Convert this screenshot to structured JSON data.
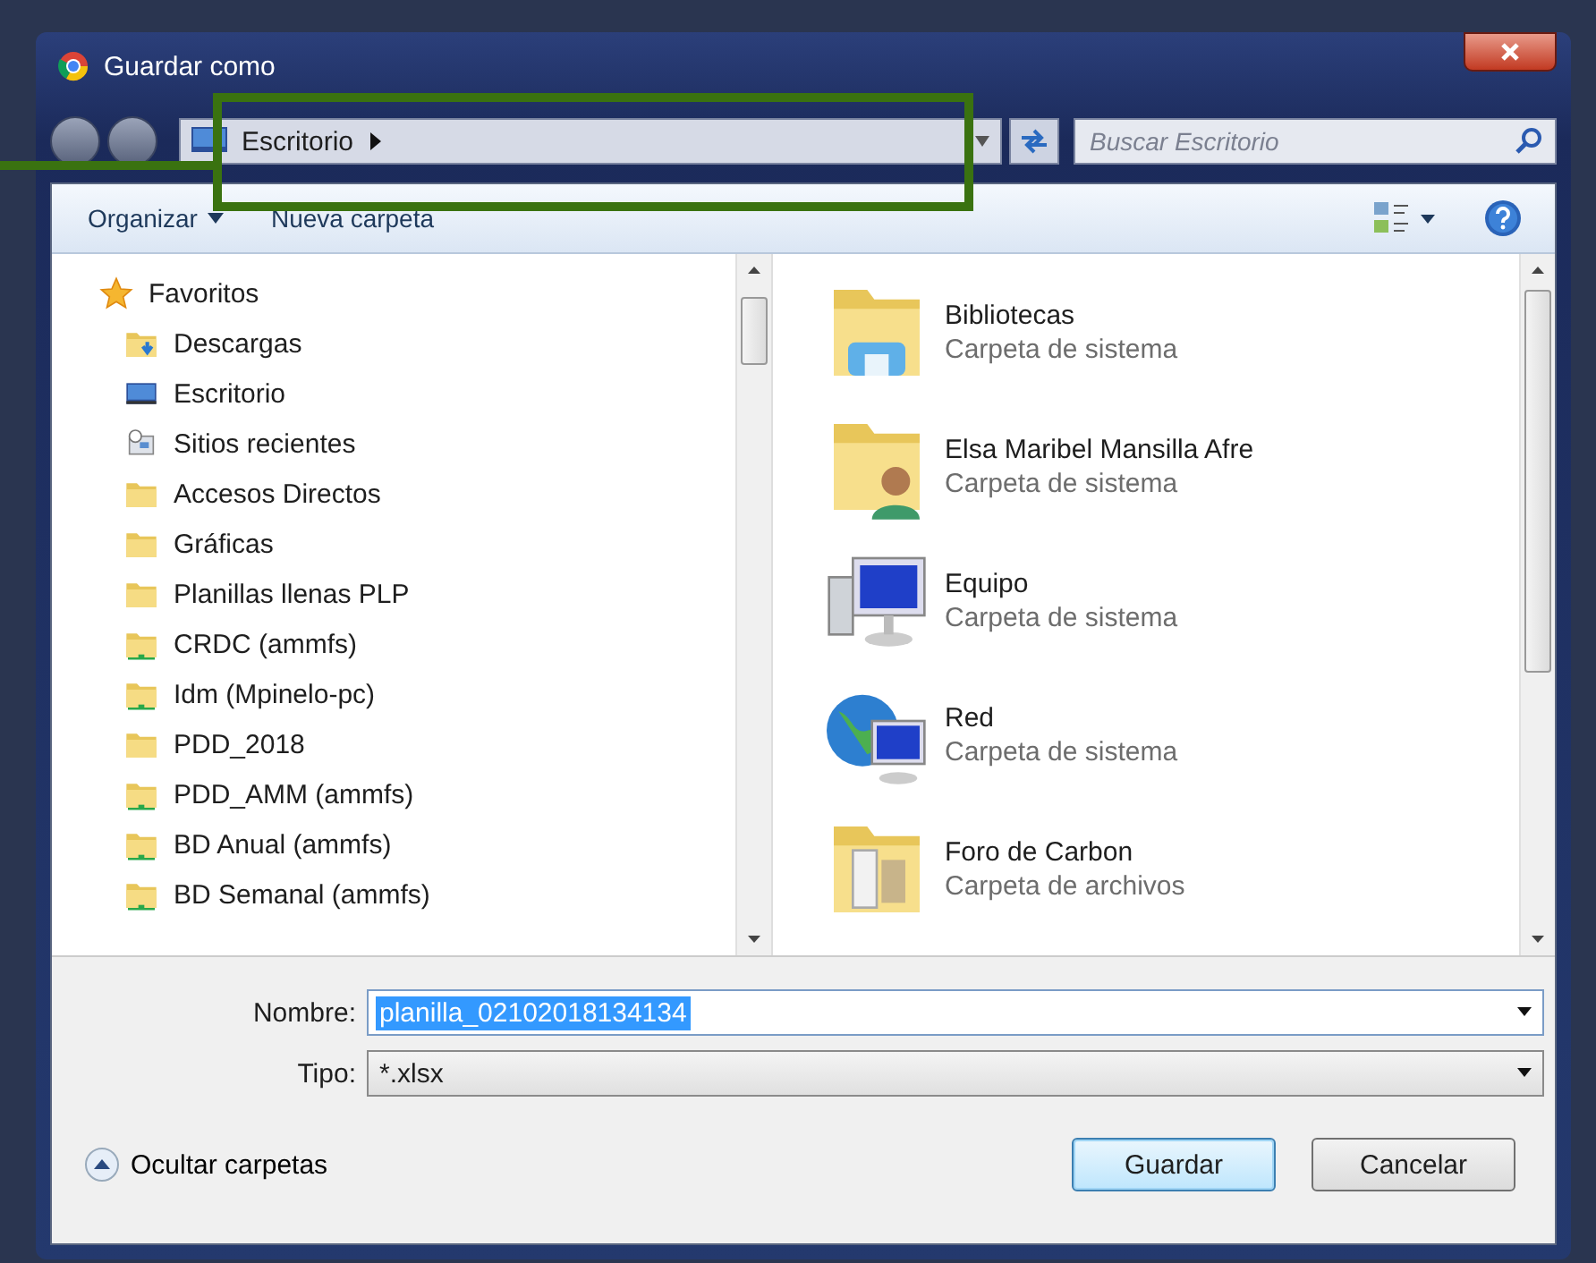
{
  "window": {
    "title": "Guardar como"
  },
  "address": {
    "path": "Escritorio"
  },
  "search": {
    "placeholder": "Buscar Escritorio"
  },
  "toolbar": {
    "items": [
      "Organizar",
      "Nueva carpeta"
    ]
  },
  "sidebar": {
    "items": [
      {
        "label": "Favoritos",
        "kind": "star",
        "children": [
          {
            "label": "Descargas",
            "kind": "downloads"
          },
          {
            "label": "Escritorio",
            "kind": "desktop"
          },
          {
            "label": "Sitios recientes",
            "kind": "recent"
          },
          {
            "label": "Accesos Directos",
            "kind": "folder"
          },
          {
            "label": "Gráficas",
            "kind": "folder"
          },
          {
            "label": "Planillas llenas PLP",
            "kind": "folder"
          },
          {
            "label": "CRDC (ammfs)",
            "kind": "network"
          },
          {
            "label": "Idm (Mpinelo-pc)",
            "kind": "network"
          },
          {
            "label": "PDD_2018",
            "kind": "folder"
          },
          {
            "label": "PDD_AMM (ammfs)",
            "kind": "network"
          },
          {
            "label": "BD Anual (ammfs)",
            "kind": "network"
          },
          {
            "label": "BD Semanal (ammfs)",
            "kind": "network"
          }
        ]
      }
    ]
  },
  "files": [
    {
      "name": "Bibliotecas",
      "type": "Carpeta de sistema",
      "kind": "libraries"
    },
    {
      "name": "Elsa Maribel Mansilla Afre",
      "type": "Carpeta de sistema",
      "kind": "user"
    },
    {
      "name": "Equipo",
      "type": "Carpeta de sistema",
      "kind": "computer"
    },
    {
      "name": "Red",
      "type": "Carpeta de sistema",
      "kind": "network"
    },
    {
      "name": "Foro de Carbon",
      "type": "Carpeta de archivos",
      "kind": "folder"
    }
  ],
  "form": [
    {
      "label": "Nombre:",
      "value": "planilla_02102018134134",
      "selected": true
    },
    {
      "label": "Tipo:",
      "value": "*.xlsx",
      "selected": false
    }
  ],
  "hide_folders": "Ocultar carpetas",
  "buttons": [
    {
      "label": "Guardar",
      "default": true
    },
    {
      "label": "Cancelar",
      "default": false
    }
  ]
}
